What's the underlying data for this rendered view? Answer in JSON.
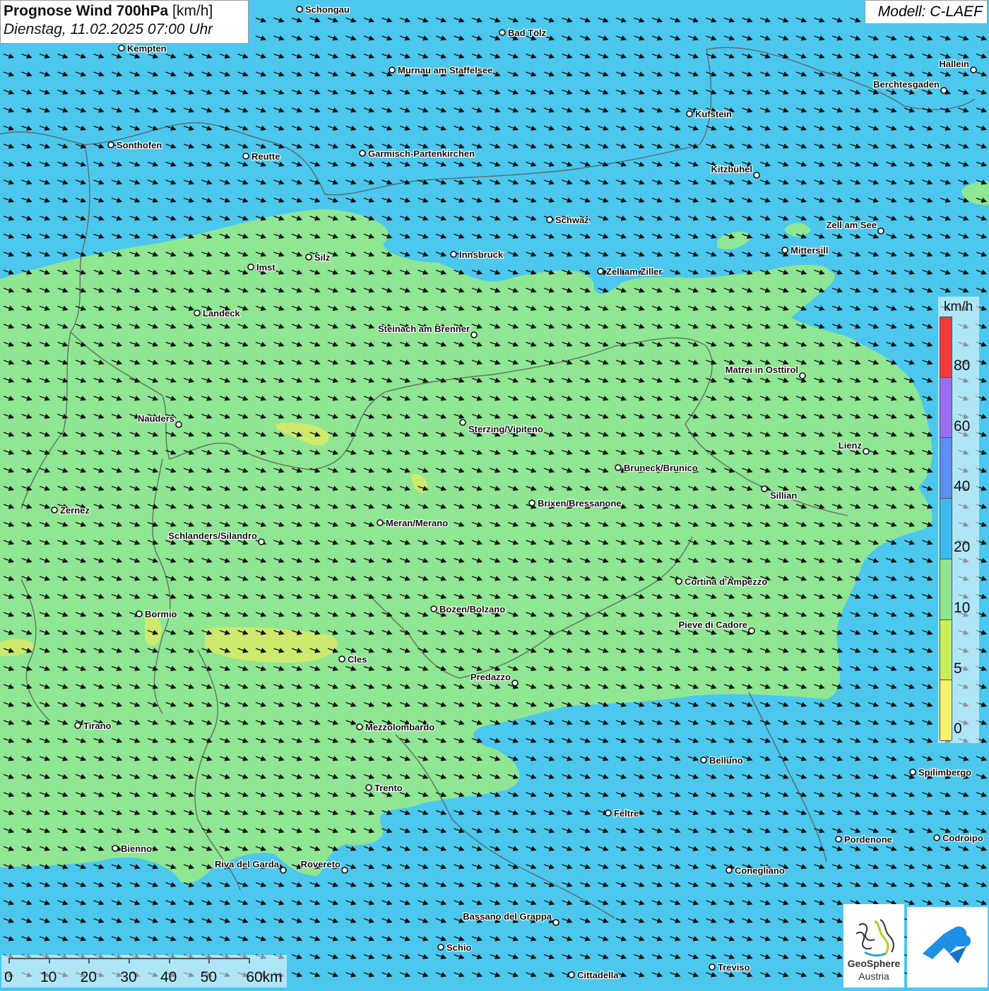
{
  "header": {
    "title_bold": "Prognose Wind 700hPa",
    "title_unit": "[km/h]",
    "datetime": "Dienstag, 11.02.2025 07:00 Uhr",
    "model": "Modell: C-LAEF"
  },
  "legend": {
    "unit": "km/h",
    "labels": [
      "80",
      "60",
      "40",
      "20",
      "10",
      "5",
      "0"
    ],
    "colors": [
      "#f23a3a",
      "#9a6ef0",
      "#5b8ff0",
      "#3bb9ec",
      "#8ee58e",
      "#c6ef5a",
      "#f5f16a"
    ]
  },
  "scalebar": {
    "labels": [
      "0",
      "10",
      "20",
      "30",
      "40",
      "50",
      "60km"
    ]
  },
  "branding": {
    "org_line1": "GeoSphere",
    "org_line2": "Austria"
  },
  "map": {
    "background_color": "#4cc8ee",
    "green_color": "#8fe693",
    "yellow_green_color": "#cdea6e",
    "arrow_direction": "east-southeast",
    "cities": [
      {
        "name": "Schongau"
      },
      {
        "name": "Bad Tölz"
      },
      {
        "name": "Kempten"
      },
      {
        "name": "Murnau am Staffelsee"
      },
      {
        "name": "Hallein"
      },
      {
        "name": "Berchtesgaden"
      },
      {
        "name": "Kufstein"
      },
      {
        "name": "Sonthofen"
      },
      {
        "name": "Reutte"
      },
      {
        "name": "Garmisch-Partenkirchen"
      },
      {
        "name": "Kitzbühel"
      },
      {
        "name": "Schwaz"
      },
      {
        "name": "Zell am See"
      },
      {
        "name": "Mittersill"
      },
      {
        "name": "Innsbruck"
      },
      {
        "name": "Silz"
      },
      {
        "name": "Imst"
      },
      {
        "name": "Zell am Ziller"
      },
      {
        "name": "Landeck"
      },
      {
        "name": "Steinach am Brenner"
      },
      {
        "name": "Matrei in Osttirol"
      },
      {
        "name": "Nauders"
      },
      {
        "name": "Sterzing/Vipiteno"
      },
      {
        "name": "Lienz"
      },
      {
        "name": "Bruneck/Brunico"
      },
      {
        "name": "Sillian"
      },
      {
        "name": "Brixen/Bressanone"
      },
      {
        "name": "Zernez"
      },
      {
        "name": "Meran/Merano"
      },
      {
        "name": "Schlanders/Silandro"
      },
      {
        "name": "Cortina d'Ampezzo"
      },
      {
        "name": "Bozen/Bolzano"
      },
      {
        "name": "Bormio"
      },
      {
        "name": "Pieve di Cadore"
      },
      {
        "name": "Cles"
      },
      {
        "name": "Predazzo"
      },
      {
        "name": "Tirano"
      },
      {
        "name": "Mezzolombardo"
      },
      {
        "name": "Belluno"
      },
      {
        "name": "Spilimbergo"
      },
      {
        "name": "Trento"
      },
      {
        "name": "Feltre"
      },
      {
        "name": "Pordenone"
      },
      {
        "name": "Codroipo"
      },
      {
        "name": "Bienno"
      },
      {
        "name": "Riva del Garda"
      },
      {
        "name": "Rovereto"
      },
      {
        "name": "Conegliano"
      },
      {
        "name": "Bassano del Grappa"
      },
      {
        "name": "Schio"
      },
      {
        "name": "Treviso"
      },
      {
        "name": "Cittadella"
      }
    ]
  }
}
